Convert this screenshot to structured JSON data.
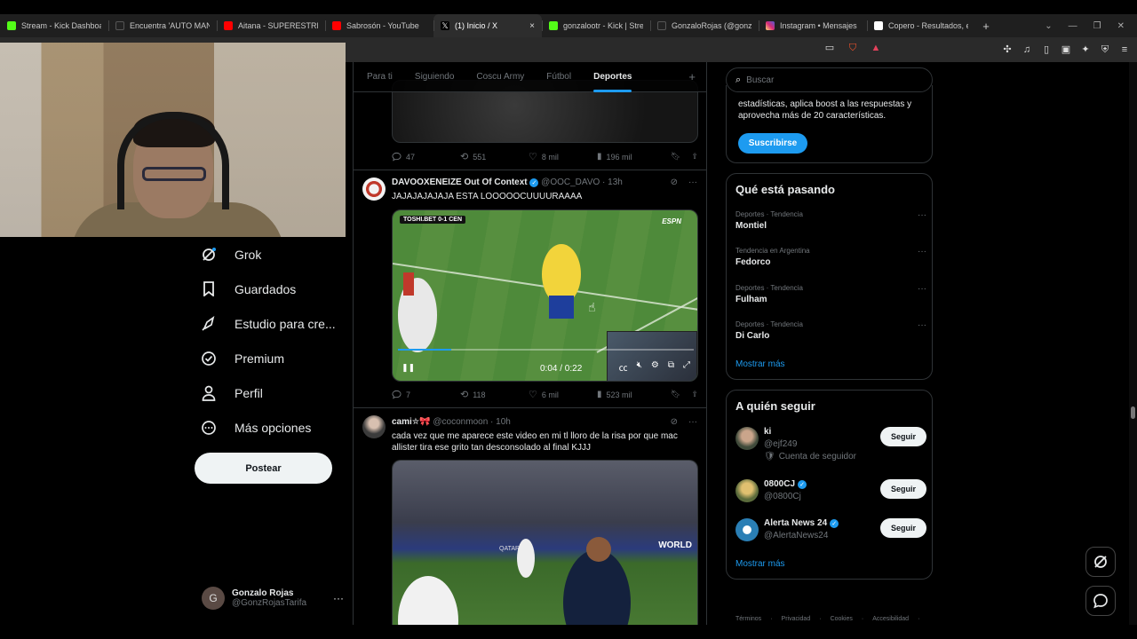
{
  "browser": {
    "tabs": [
      {
        "label": "Stream - Kick Dashboard",
        "color": "#53fc18"
      },
      {
        "label": "Encuentra 'AUTO MANEJ",
        "color": "#111111"
      },
      {
        "label": "Aitana - SUPERESTRELLA",
        "color": "#ff0000"
      },
      {
        "label": "Sabrosón - YouTube",
        "color": "#ff0000"
      },
      {
        "label": "(1) Inicio / X",
        "color": "#000000"
      },
      {
        "label": "gonzalootr - Kick | Stream",
        "color": "#53fc18"
      },
      {
        "label": "GonzaloRojas (@gonzalot",
        "color": "#111111"
      },
      {
        "label": "Instagram • Mensajes",
        "color": "#d62976"
      },
      {
        "label": "Copero - Resultados, esta",
        "color": "#ffffff"
      }
    ],
    "active_tab_close": "×",
    "new_tab": "+"
  },
  "sidebar": {
    "items": [
      {
        "label": "Grok",
        "icon": "grok-icon"
      },
      {
        "label": "Guardados",
        "icon": "bookmark-icon"
      },
      {
        "label": "Estudio para cre...",
        "icon": "rocket-icon"
      },
      {
        "label": "Premium",
        "icon": "premium-icon"
      },
      {
        "label": "Perfil",
        "icon": "profile-icon"
      },
      {
        "label": "Más opciones",
        "icon": "more-options-icon"
      }
    ],
    "post_button": "Postear",
    "account": {
      "initial": "G",
      "name": "Gonzalo Rojas",
      "handle": "@GonzRojasTarifa",
      "more": "···"
    }
  },
  "timeline": {
    "tabs": [
      {
        "label": "Para ti",
        "active": false
      },
      {
        "label": "Siguiendo",
        "active": false
      },
      {
        "label": "Coscu Army",
        "active": false
      },
      {
        "label": "Fútbol",
        "active": false
      },
      {
        "label": "Deportes",
        "active": true
      }
    ],
    "add_tab": "+",
    "prev_post": {
      "replies": "47",
      "reposts": "551",
      "likes": "8 mil",
      "views": "196 mil"
    },
    "posts": [
      {
        "name": "DAVOOXENEIZE Out Of Context",
        "handle": "@OOC_DAVO",
        "time": "· 13h",
        "text": "JAJAJAJAJAJA ESTA LOOOOOCUUUURAAAA",
        "video": {
          "time": "0:04 / 0:22",
          "scoreboard": "TOSHI.BET  0-1  CEN",
          "broadcaster": "ESPN"
        },
        "replies": "7",
        "reposts": "118",
        "likes": "6 mil",
        "views": "523 mil"
      },
      {
        "name": "cami✮🎀",
        "handle": "@coconmoon",
        "time": "· 10h",
        "text": "cada vez que me aparece este video en mi tl lloro de la risa por que mac allister tira ese grito tan desconsolado al final KJJJ",
        "video": {
          "board": "WORLD",
          "banner": "QATAR AIR"
        }
      }
    ]
  },
  "right": {
    "search_placeholder": "Buscar",
    "premium": {
      "text": "estadísticas, aplica boost a las respuestas y aprovecha más de 20 características.",
      "button": "Suscribirse"
    },
    "trending": {
      "title": "Qué está pasando",
      "items": [
        {
          "context": "Deportes · Tendencia",
          "name": "Montiel"
        },
        {
          "context": "Tendencia en Argentina",
          "name": "Fedorco"
        },
        {
          "context": "Deportes · Tendencia",
          "name": "Fulham"
        },
        {
          "context": "Deportes · Tendencia",
          "name": "Di Carlo"
        }
      ],
      "more": "Mostrar más"
    },
    "who_to_follow": {
      "title": "A quién seguir",
      "items": [
        {
          "name": "ki",
          "handle": "@ejf249",
          "extra": "Cuenta de seguidor",
          "verified": false,
          "button": "Seguir",
          "color": "#6b7f6a"
        },
        {
          "name": "0800CJ",
          "handle": "@0800Cj",
          "extra": "",
          "verified": true,
          "button": "Seguir",
          "color": "#8a9a5b"
        },
        {
          "name": "Alerta News 24",
          "handle": "@AlertaNews24",
          "extra": "",
          "verified": true,
          "button": "Seguir",
          "color": "#2a7fb5"
        }
      ],
      "more": "Mostrar más"
    },
    "footer": [
      "Términos",
      "Privacidad",
      "Cookies",
      "Accesibilidad"
    ]
  },
  "colors": {
    "accent": "#1d9bf0",
    "border": "#2f3336",
    "muted": "#71767b"
  }
}
